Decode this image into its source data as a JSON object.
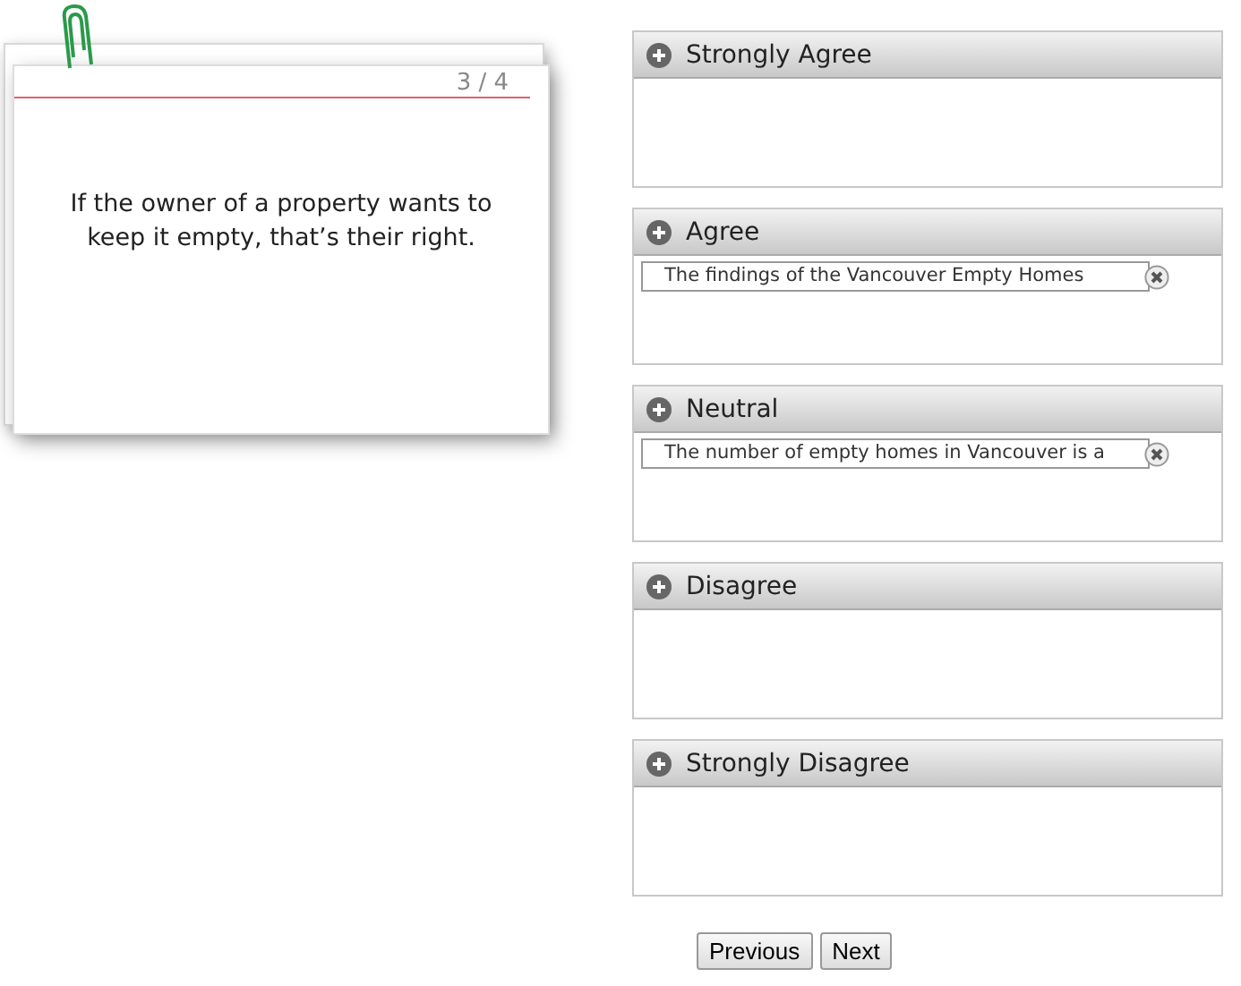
{
  "card": {
    "counter": "3 / 4",
    "statement": "If the owner of a property wants to keep it empty, that’s their right."
  },
  "categories": [
    {
      "title": "Strongly Agree"
    },
    {
      "title": "Agree",
      "items": [
        "The findings of the Vancouver Empty Homes"
      ]
    },
    {
      "title": "Neutral",
      "items": [
        "The number of empty homes in Vancouver is a"
      ]
    },
    {
      "title": "Disagree"
    },
    {
      "title": "Strongly Disagree"
    }
  ],
  "buttons": [
    "Previous",
    "Next"
  ]
}
